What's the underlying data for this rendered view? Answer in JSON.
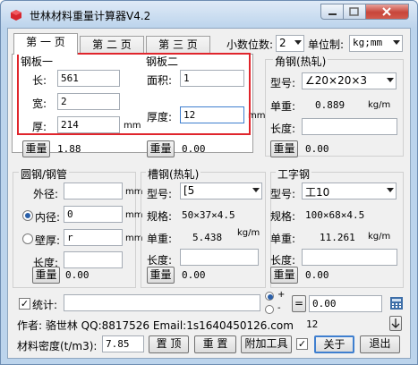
{
  "window": {
    "title": "世林材料重量计算器V4.2"
  },
  "tabs": [
    "第 一 页",
    "第 二 页",
    "第 三 页"
  ],
  "settings": {
    "decimals_label": "小数位数:",
    "decimals_value": "2",
    "unit_label": "单位制:",
    "unit_value": "kg;mm"
  },
  "plate1": {
    "title": "钢板一",
    "length_label": "长:",
    "length": "561",
    "width_label": "宽:",
    "width": "2",
    "thickness_label": "厚:",
    "thickness": "214",
    "unit": "mm",
    "weight_btn": "重量",
    "weight": "1.88"
  },
  "plate2": {
    "title": "钢板二",
    "area_label": "面积:",
    "area": "1",
    "thickness_label": "厚度:",
    "thickness": "12",
    "unit": "mm",
    "weight_btn": "重量",
    "weight": "0.00"
  },
  "angle": {
    "title": "角钢(热轧)",
    "model_label": "型号:",
    "model": "∠20×20×3",
    "unit_weight_label": "单重:",
    "unit_weight": "0.889",
    "unit_weight_unit": "kg/m",
    "length_label": "长度:",
    "length": "",
    "weight_btn": "重量",
    "weight": "0.00"
  },
  "pipe": {
    "title": "圆钢/钢管",
    "outer_label": "外径:",
    "outer": "",
    "inner_label": "内径:",
    "inner": "0",
    "wall_label": "壁厚:",
    "wall": "r",
    "unit": "mm",
    "length_label": "长度:",
    "length": "",
    "weight_btn": "重量",
    "weight": "0.00"
  },
  "channel": {
    "title": "槽钢(热轧)",
    "model_label": "型号:",
    "model": "[5",
    "spec_label": "规格:",
    "spec": "50×37×4.5",
    "unit_weight_label": "单重:",
    "unit_weight": "5.438",
    "unit_weight_unit": "kg/m",
    "length_label": "长度:",
    "length": "",
    "weight_btn": "重量",
    "weight": "0.00"
  },
  "ibeam": {
    "title": "工字钢",
    "model_label": "型号:",
    "model": "工10",
    "spec_label": "规格:",
    "spec": "100×68×4.5",
    "unit_weight_label": "单重:",
    "unit_weight": "11.261",
    "unit_weight_unit": "kg/m",
    "length_label": "长度:",
    "length": "",
    "weight_btn": "重量",
    "weight": "0.00"
  },
  "stats": {
    "label": "统计:",
    "plus": "+",
    "minus": "-",
    "equals_btn": "=",
    "result": "0.00"
  },
  "footer": {
    "author": "作者: 骆世林 QQ:8817526  Email:1s1640450126.com",
    "count": "12",
    "density_label": "材料密度(t/m3):",
    "density": "7.85",
    "top_btn": "置 顶",
    "reset_btn": "重 置",
    "tools_btn": "附加工具",
    "about_btn": "关于",
    "exit_btn": "退出"
  }
}
